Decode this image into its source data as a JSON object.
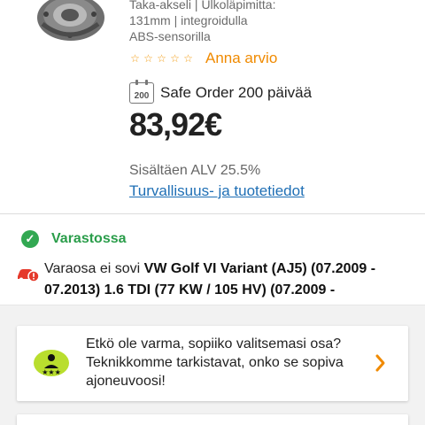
{
  "product": {
    "spec_line_1": "Taka-akseli | Ulkoläpimitta:",
    "spec_line_2": "131mm | integroidulla",
    "spec_line_3": "ABS-sensorilla",
    "rating_link": "Anna arvio",
    "stars_filled": 0,
    "stars_total": 5
  },
  "safe_order": {
    "badge": "200",
    "text": "Safe Order 200 päivää"
  },
  "price": {
    "value": "83,92€",
    "vat_text": "Sisältäen ALV 25.5%",
    "safety_link": "Turvallisuus- ja tuotetiedot"
  },
  "stock": {
    "status": "Varastossa",
    "status_color": "#2a9d4a",
    "fit_prefix": "Varaosa ei sovi ",
    "fit_vehicle": "VW Golf VI Variant (AJ5) (07.2009 - 07.2013) 1.6 TDI (77 KW / 105 HV) (07.2009 -"
  },
  "help_card": {
    "text": "Etkö ole varma, sopiiko valitsemasi osa? Teknikkomme tarkistavat, onko se sopiva ajoneuvoosi!"
  },
  "colors": {
    "accent_orange": "#f08a00",
    "link_blue": "#1f6fb5",
    "success_green": "#32a852",
    "warning_red": "#e5392b",
    "help_icon_green": "#b9de2e"
  },
  "icons": {
    "product_image": "wheel-hub-image",
    "safe_order": "calendar-200-icon",
    "stock": "check-circle-icon",
    "fit": "car-warning-icon",
    "help": "technician-icon",
    "chevron": "chevron-right-icon"
  }
}
